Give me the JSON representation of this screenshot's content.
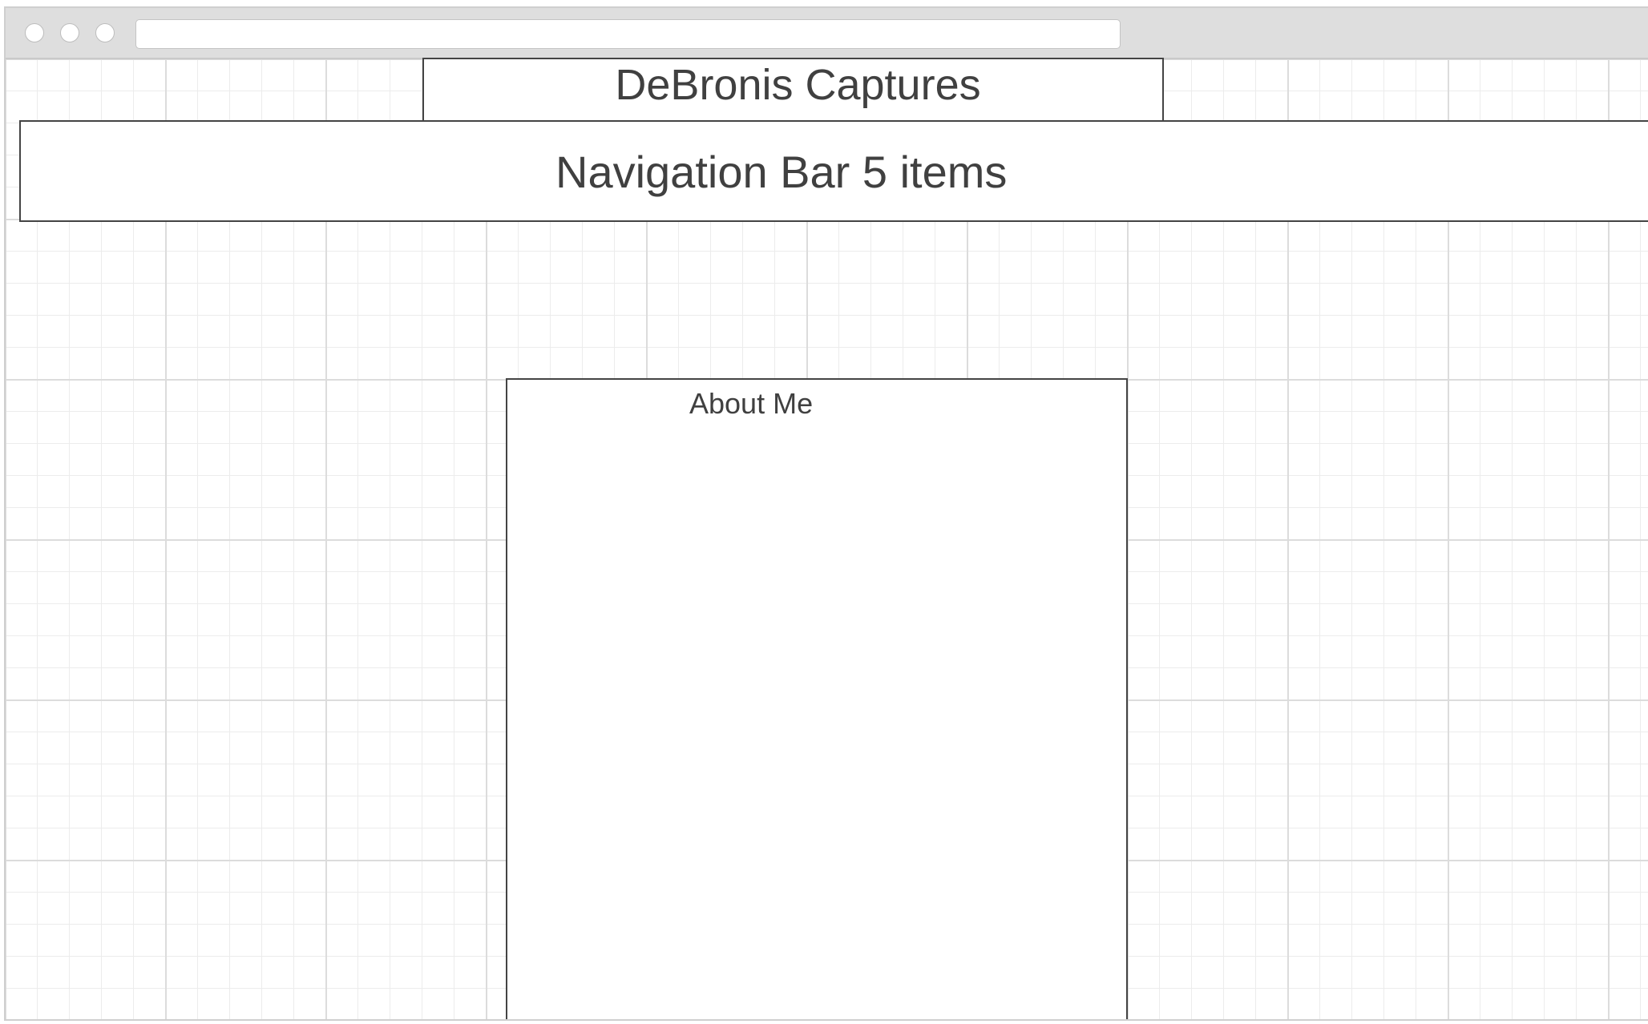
{
  "header": {
    "site_title": "DeBronis Captures"
  },
  "navigation": {
    "label": "Navigation Bar 5 items"
  },
  "main": {
    "about_heading": "About Me"
  },
  "colors": {
    "titlebar": "#dedede",
    "border": "#444444",
    "text": "#404040",
    "grid": "#dcdcdc"
  }
}
